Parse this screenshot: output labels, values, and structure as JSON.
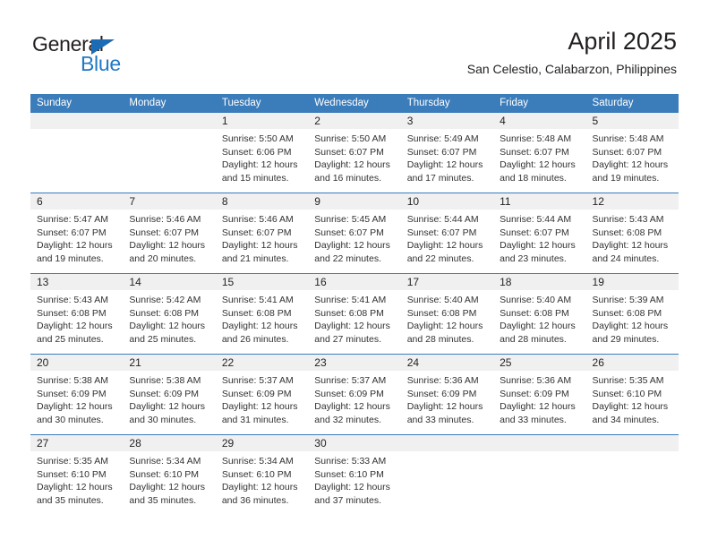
{
  "brand": {
    "name_part1": "General",
    "name_part2": "Blue",
    "accent_color": "#2079c7",
    "triangle_color": "#1b6cb5"
  },
  "header": {
    "title": "April 2025",
    "subtitle": "San Celestio, Calabarzon, Philippines"
  },
  "calendar": {
    "header_bg": "#3b7cba",
    "day_band_bg": "#f0f0f0",
    "weekdays": [
      "Sunday",
      "Monday",
      "Tuesday",
      "Wednesday",
      "Thursday",
      "Friday",
      "Saturday"
    ],
    "weeks": [
      [
        {
          "day": "",
          "lines": []
        },
        {
          "day": "",
          "lines": []
        },
        {
          "day": "1",
          "lines": [
            "Sunrise: 5:50 AM",
            "Sunset: 6:06 PM",
            "Daylight: 12 hours",
            "and 15 minutes."
          ]
        },
        {
          "day": "2",
          "lines": [
            "Sunrise: 5:50 AM",
            "Sunset: 6:07 PM",
            "Daylight: 12 hours",
            "and 16 minutes."
          ]
        },
        {
          "day": "3",
          "lines": [
            "Sunrise: 5:49 AM",
            "Sunset: 6:07 PM",
            "Daylight: 12 hours",
            "and 17 minutes."
          ]
        },
        {
          "day": "4",
          "lines": [
            "Sunrise: 5:48 AM",
            "Sunset: 6:07 PM",
            "Daylight: 12 hours",
            "and 18 minutes."
          ]
        },
        {
          "day": "5",
          "lines": [
            "Sunrise: 5:48 AM",
            "Sunset: 6:07 PM",
            "Daylight: 12 hours",
            "and 19 minutes."
          ]
        }
      ],
      [
        {
          "day": "6",
          "lines": [
            "Sunrise: 5:47 AM",
            "Sunset: 6:07 PM",
            "Daylight: 12 hours",
            "and 19 minutes."
          ]
        },
        {
          "day": "7",
          "lines": [
            "Sunrise: 5:46 AM",
            "Sunset: 6:07 PM",
            "Daylight: 12 hours",
            "and 20 minutes."
          ]
        },
        {
          "day": "8",
          "lines": [
            "Sunrise: 5:46 AM",
            "Sunset: 6:07 PM",
            "Daylight: 12 hours",
            "and 21 minutes."
          ]
        },
        {
          "day": "9",
          "lines": [
            "Sunrise: 5:45 AM",
            "Sunset: 6:07 PM",
            "Daylight: 12 hours",
            "and 22 minutes."
          ]
        },
        {
          "day": "10",
          "lines": [
            "Sunrise: 5:44 AM",
            "Sunset: 6:07 PM",
            "Daylight: 12 hours",
            "and 22 minutes."
          ]
        },
        {
          "day": "11",
          "lines": [
            "Sunrise: 5:44 AM",
            "Sunset: 6:07 PM",
            "Daylight: 12 hours",
            "and 23 minutes."
          ]
        },
        {
          "day": "12",
          "lines": [
            "Sunrise: 5:43 AM",
            "Sunset: 6:08 PM",
            "Daylight: 12 hours",
            "and 24 minutes."
          ]
        }
      ],
      [
        {
          "day": "13",
          "lines": [
            "Sunrise: 5:43 AM",
            "Sunset: 6:08 PM",
            "Daylight: 12 hours",
            "and 25 minutes."
          ]
        },
        {
          "day": "14",
          "lines": [
            "Sunrise: 5:42 AM",
            "Sunset: 6:08 PM",
            "Daylight: 12 hours",
            "and 25 minutes."
          ]
        },
        {
          "day": "15",
          "lines": [
            "Sunrise: 5:41 AM",
            "Sunset: 6:08 PM",
            "Daylight: 12 hours",
            "and 26 minutes."
          ]
        },
        {
          "day": "16",
          "lines": [
            "Sunrise: 5:41 AM",
            "Sunset: 6:08 PM",
            "Daylight: 12 hours",
            "and 27 minutes."
          ]
        },
        {
          "day": "17",
          "lines": [
            "Sunrise: 5:40 AM",
            "Sunset: 6:08 PM",
            "Daylight: 12 hours",
            "and 28 minutes."
          ]
        },
        {
          "day": "18",
          "lines": [
            "Sunrise: 5:40 AM",
            "Sunset: 6:08 PM",
            "Daylight: 12 hours",
            "and 28 minutes."
          ]
        },
        {
          "day": "19",
          "lines": [
            "Sunrise: 5:39 AM",
            "Sunset: 6:08 PM",
            "Daylight: 12 hours",
            "and 29 minutes."
          ]
        }
      ],
      [
        {
          "day": "20",
          "lines": [
            "Sunrise: 5:38 AM",
            "Sunset: 6:09 PM",
            "Daylight: 12 hours",
            "and 30 minutes."
          ]
        },
        {
          "day": "21",
          "lines": [
            "Sunrise: 5:38 AM",
            "Sunset: 6:09 PM",
            "Daylight: 12 hours",
            "and 30 minutes."
          ]
        },
        {
          "day": "22",
          "lines": [
            "Sunrise: 5:37 AM",
            "Sunset: 6:09 PM",
            "Daylight: 12 hours",
            "and 31 minutes."
          ]
        },
        {
          "day": "23",
          "lines": [
            "Sunrise: 5:37 AM",
            "Sunset: 6:09 PM",
            "Daylight: 12 hours",
            "and 32 minutes."
          ]
        },
        {
          "day": "24",
          "lines": [
            "Sunrise: 5:36 AM",
            "Sunset: 6:09 PM",
            "Daylight: 12 hours",
            "and 33 minutes."
          ]
        },
        {
          "day": "25",
          "lines": [
            "Sunrise: 5:36 AM",
            "Sunset: 6:09 PM",
            "Daylight: 12 hours",
            "and 33 minutes."
          ]
        },
        {
          "day": "26",
          "lines": [
            "Sunrise: 5:35 AM",
            "Sunset: 6:10 PM",
            "Daylight: 12 hours",
            "and 34 minutes."
          ]
        }
      ],
      [
        {
          "day": "27",
          "lines": [
            "Sunrise: 5:35 AM",
            "Sunset: 6:10 PM",
            "Daylight: 12 hours",
            "and 35 minutes."
          ]
        },
        {
          "day": "28",
          "lines": [
            "Sunrise: 5:34 AM",
            "Sunset: 6:10 PM",
            "Daylight: 12 hours",
            "and 35 minutes."
          ]
        },
        {
          "day": "29",
          "lines": [
            "Sunrise: 5:34 AM",
            "Sunset: 6:10 PM",
            "Daylight: 12 hours",
            "and 36 minutes."
          ]
        },
        {
          "day": "30",
          "lines": [
            "Sunrise: 5:33 AM",
            "Sunset: 6:10 PM",
            "Daylight: 12 hours",
            "and 37 minutes."
          ]
        },
        {
          "day": "",
          "lines": []
        },
        {
          "day": "",
          "lines": []
        },
        {
          "day": "",
          "lines": []
        }
      ]
    ]
  }
}
